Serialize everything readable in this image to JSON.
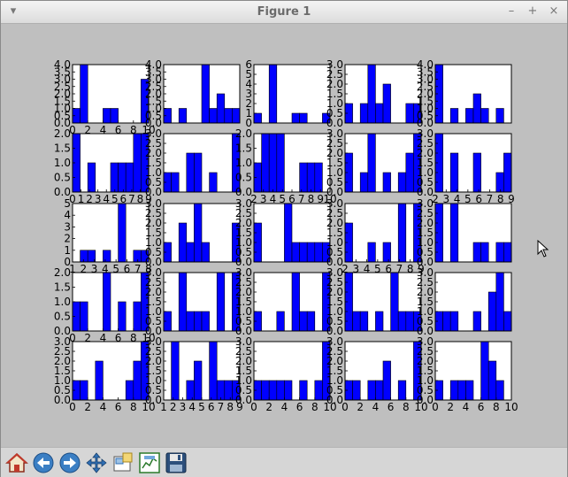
{
  "window": {
    "title": "Figure 1",
    "menu_icon": "chevron-down-icon",
    "min_icon": "minimize-icon",
    "max_icon": "maximize-icon",
    "close_icon": "close-icon"
  },
  "toolbar": {
    "buttons": [
      {
        "name": "home-button",
        "icon": "home-icon"
      },
      {
        "name": "back-button",
        "icon": "arrow-left-icon"
      },
      {
        "name": "forward-button",
        "icon": "arrow-right-icon"
      },
      {
        "name": "pan-button",
        "icon": "move-icon"
      },
      {
        "name": "zoom-button",
        "icon": "zoom-rect-icon"
      },
      {
        "name": "configure-button",
        "icon": "subplots-icon"
      },
      {
        "name": "save-button",
        "icon": "floppy-disk-icon"
      }
    ]
  },
  "colors": {
    "bar": "#0000ff",
    "window_bg": "#bfbfbf",
    "axes_bg": "#ffffff"
  },
  "chart_data": [
    {
      "type": "bar",
      "row": 0,
      "col": 0,
      "bins": 10,
      "values": [
        1,
        4,
        0,
        0,
        1,
        1,
        0,
        0,
        0,
        3
      ],
      "xticks": [
        "0",
        "2",
        "4",
        "6",
        "8",
        "10"
      ],
      "yticks": [
        "0.0",
        "0.5",
        "1.0",
        "1.5",
        "2.0",
        "2.5",
        "3.0",
        "3.5",
        "4.0"
      ],
      "ylim": [
        0,
        4
      ]
    },
    {
      "type": "bar",
      "row": 0,
      "col": 1,
      "bins": 10,
      "values": [
        1,
        0,
        1,
        0,
        0,
        4,
        1,
        2,
        1,
        1
      ],
      "xticks": [],
      "yticks": [
        "0.0",
        "0.5",
        "1.0",
        "1.5",
        "2.0",
        "2.5",
        "3.0",
        "3.5",
        "4.0"
      ],
      "ylim": [
        0,
        4
      ]
    },
    {
      "type": "bar",
      "row": 0,
      "col": 2,
      "bins": 10,
      "values": [
        1,
        0,
        6,
        0,
        0,
        1,
        1,
        0,
        0,
        1
      ],
      "xticks": [],
      "yticks": [
        "0",
        "1",
        "2",
        "3",
        "4",
        "5",
        "6"
      ],
      "ylim": [
        0,
        6
      ]
    },
    {
      "type": "bar",
      "row": 0,
      "col": 3,
      "bins": 10,
      "values": [
        1,
        0,
        1,
        3,
        1,
        2,
        0,
        0,
        1,
        1
      ],
      "xticks": [],
      "yticks": [
        "0.0",
        "0.5",
        "1.0",
        "1.5",
        "2.0",
        "2.5",
        "3.0"
      ],
      "ylim": [
        0,
        3
      ]
    },
    {
      "type": "bar",
      "row": 0,
      "col": 4,
      "bins": 10,
      "values": [
        4,
        0,
        1,
        0,
        1,
        2,
        1,
        0,
        1,
        0
      ],
      "xticks": [],
      "yticks": [
        "0.0",
        "0.5",
        "1.0",
        "1.5",
        "2.0",
        "2.5",
        "3.0",
        "3.5",
        "4.0"
      ],
      "ylim": [
        0,
        4
      ]
    },
    {
      "type": "bar",
      "row": 1,
      "col": 0,
      "bins": 10,
      "values": [
        2,
        0,
        1,
        0,
        0,
        1,
        1,
        1,
        2,
        2
      ],
      "xticks": [
        "0",
        "1",
        "2",
        "3",
        "4",
        "5",
        "6",
        "7",
        "8",
        "9"
      ],
      "yticks": [
        "0.0",
        "0.5",
        "1.0",
        "1.5",
        "2.0"
      ],
      "ylim": [
        0,
        2
      ]
    },
    {
      "type": "bar",
      "row": 1,
      "col": 1,
      "bins": 10,
      "values": [
        1,
        1,
        0,
        2,
        2,
        0,
        1,
        0,
        0,
        3
      ],
      "xticks": [],
      "yticks": [
        "0.0",
        "0.5",
        "1.0",
        "1.5",
        "2.0",
        "2.5",
        "3.0"
      ],
      "ylim": [
        0,
        3
      ]
    },
    {
      "type": "bar",
      "row": 1,
      "col": 2,
      "bins": 10,
      "values": [
        1,
        2,
        2,
        2,
        0,
        0,
        1,
        1,
        1,
        0
      ],
      "xticks": [
        "2",
        "3",
        "4",
        "5",
        "6",
        "7",
        "8",
        "9",
        "10"
      ],
      "yticks": [
        "0.0",
        "0.5",
        "1.0",
        "1.5",
        "2.0"
      ],
      "ylim": [
        0,
        2
      ]
    },
    {
      "type": "bar",
      "row": 1,
      "col": 3,
      "bins": 10,
      "values": [
        2,
        0,
        1,
        3,
        0,
        1,
        0,
        1,
        2,
        3
      ],
      "xticks": [],
      "yticks": [
        "0.0",
        "0.5",
        "1.0",
        "1.5",
        "2.0",
        "2.5",
        "3.0"
      ],
      "ylim": [
        0,
        3
      ]
    },
    {
      "type": "bar",
      "row": 1,
      "col": 4,
      "bins": 10,
      "values": [
        3,
        0,
        2,
        0,
        0,
        2,
        0,
        0,
        1,
        2
      ],
      "xticks": [
        "2",
        "3",
        "4",
        "5",
        "6",
        "7",
        "8",
        "9"
      ],
      "yticks": [
        "0.0",
        "0.5",
        "1.0",
        "1.5",
        "2.0",
        "2.5",
        "3.0"
      ],
      "ylim": [
        0,
        3
      ]
    },
    {
      "type": "bar",
      "row": 2,
      "col": 0,
      "bins": 10,
      "values": [
        0,
        1,
        1,
        0,
        1,
        0,
        5,
        0,
        1,
        1
      ],
      "xticks": [
        "1",
        "2",
        "3",
        "4",
        "5",
        "6",
        "7",
        "8"
      ],
      "yticks": [
        "0",
        "1",
        "2",
        "3",
        "4",
        "5"
      ],
      "ylim": [
        0,
        5
      ]
    },
    {
      "type": "bar",
      "row": 2,
      "col": 1,
      "bins": 10,
      "values": [
        1,
        0,
        2,
        1,
        3,
        1,
        0,
        0,
        0,
        2
      ],
      "xticks": [],
      "yticks": [
        "0.0",
        "0.5",
        "1.0",
        "1.5",
        "2.0",
        "2.5",
        "3.0"
      ],
      "ylim": [
        0,
        3
      ]
    },
    {
      "type": "bar",
      "row": 2,
      "col": 2,
      "bins": 10,
      "values": [
        2,
        0,
        0,
        0,
        3,
        1,
        1,
        1,
        1,
        1
      ],
      "xticks": [],
      "yticks": [
        "0.0",
        "0.5",
        "1.0",
        "1.5",
        "2.0",
        "2.5",
        "3.0"
      ],
      "ylim": [
        0,
        3
      ]
    },
    {
      "type": "bar",
      "row": 2,
      "col": 3,
      "bins": 10,
      "values": [
        2,
        0,
        0,
        1,
        0,
        1,
        0,
        3,
        0,
        3
      ],
      "xticks": [
        "2",
        "3",
        "4",
        "5",
        "6",
        "7",
        "8",
        "9"
      ],
      "yticks": [
        "0.0",
        "0.5",
        "1.0",
        "1.5",
        "2.0",
        "2.5",
        "3.0"
      ],
      "ylim": [
        0,
        3
      ]
    },
    {
      "type": "bar",
      "row": 2,
      "col": 4,
      "bins": 10,
      "values": [
        3,
        0,
        3,
        0,
        0,
        1,
        1,
        0,
        1,
        1
      ],
      "xticks": [],
      "yticks": [
        "0.0",
        "0.5",
        "1.0",
        "1.5",
        "2.0",
        "2.5",
        "3.0"
      ],
      "ylim": [
        0,
        3
      ]
    },
    {
      "type": "bar",
      "row": 3,
      "col": 0,
      "bins": 10,
      "values": [
        1,
        1,
        0,
        0,
        2,
        0,
        1,
        0,
        1,
        2
      ],
      "xticks": [
        "0",
        "2",
        "4",
        "6",
        "8",
        "10"
      ],
      "yticks": [
        "0.0",
        "0.5",
        "1.0",
        "1.5",
        "2.0"
      ],
      "ylim": [
        0,
        2
      ]
    },
    {
      "type": "bar",
      "row": 3,
      "col": 1,
      "bins": 10,
      "values": [
        1,
        0,
        3,
        1,
        1,
        1,
        0,
        3,
        0,
        3
      ],
      "xticks": [],
      "yticks": [
        "0.0",
        "0.5",
        "1.0",
        "1.5",
        "2.0",
        "2.5",
        "3.0"
      ],
      "ylim": [
        0,
        3
      ]
    },
    {
      "type": "bar",
      "row": 3,
      "col": 2,
      "bins": 10,
      "values": [
        1,
        0,
        0,
        1,
        0,
        3,
        1,
        1,
        0,
        3
      ],
      "xticks": [],
      "yticks": [
        "0.0",
        "0.5",
        "1.0",
        "1.5",
        "2.0",
        "2.5",
        "3.0"
      ],
      "ylim": [
        0,
        3
      ]
    },
    {
      "type": "bar",
      "row": 3,
      "col": 3,
      "bins": 10,
      "values": [
        3,
        1,
        1,
        0,
        1,
        0,
        3,
        1,
        1,
        1
      ],
      "xticks": [],
      "yticks": [
        "0.0",
        "0.5",
        "1.0",
        "1.5",
        "2.0",
        "2.5",
        "3.0"
      ],
      "ylim": [
        0,
        3
      ]
    },
    {
      "type": "bar",
      "row": 3,
      "col": 4,
      "bins": 10,
      "values": [
        1,
        1,
        1,
        0,
        0,
        1,
        0,
        2,
        3,
        1
      ],
      "xticks": [],
      "yticks": [
        "0.0",
        "0.5",
        "1.0",
        "1.5",
        "2.0",
        "2.5",
        "3.0"
      ],
      "ylim": [
        0,
        3
      ]
    },
    {
      "type": "bar",
      "row": 4,
      "col": 0,
      "bins": 10,
      "values": [
        1,
        1,
        0,
        2,
        0,
        0,
        0,
        1,
        2,
        3
      ],
      "xticks": [
        "0",
        "2",
        "4",
        "6",
        "8",
        "10"
      ],
      "yticks": [
        "0.0",
        "0.5",
        "1.0",
        "1.5",
        "2.0",
        "2.5",
        "3.0"
      ],
      "ylim": [
        0,
        3
      ]
    },
    {
      "type": "bar",
      "row": 4,
      "col": 1,
      "bins": 10,
      "values": [
        0,
        3,
        0,
        1,
        2,
        0,
        3,
        1,
        1,
        1
      ],
      "xticks": [
        "1",
        "2",
        "3",
        "4",
        "5",
        "6",
        "7",
        "8",
        "9"
      ],
      "yticks": [
        "0.0",
        "0.5",
        "1.0",
        "1.5",
        "2.0",
        "2.5",
        "3.0"
      ],
      "ylim": [
        0,
        3
      ]
    },
    {
      "type": "bar",
      "row": 4,
      "col": 2,
      "bins": 10,
      "values": [
        1,
        1,
        1,
        1,
        1,
        0,
        1,
        0,
        1,
        3
      ],
      "xticks": [
        "0",
        "2",
        "4",
        "6",
        "8",
        "10"
      ],
      "yticks": [
        "0.0",
        "0.5",
        "1.0",
        "1.5",
        "2.0",
        "2.5",
        "3.0"
      ],
      "ylim": [
        0,
        3
      ]
    },
    {
      "type": "bar",
      "row": 4,
      "col": 3,
      "bins": 10,
      "values": [
        1,
        1,
        0,
        1,
        1,
        2,
        0,
        1,
        0,
        3
      ],
      "xticks": [
        "0",
        "2",
        "4",
        "6",
        "8",
        "10"
      ],
      "yticks": [
        "0.0",
        "0.5",
        "1.0",
        "1.5",
        "2.0",
        "2.5",
        "3.0"
      ],
      "ylim": [
        0,
        3
      ]
    },
    {
      "type": "bar",
      "row": 4,
      "col": 4,
      "bins": 10,
      "values": [
        1,
        0,
        1,
        1,
        1,
        0,
        3,
        2,
        1,
        0
      ],
      "xticks": [
        "0",
        "2",
        "4",
        "6",
        "8",
        "10"
      ],
      "yticks": [
        "0.0",
        "0.5",
        "1.0",
        "1.5",
        "2.0",
        "2.5",
        "3.0"
      ],
      "ylim": [
        0,
        3
      ]
    }
  ]
}
